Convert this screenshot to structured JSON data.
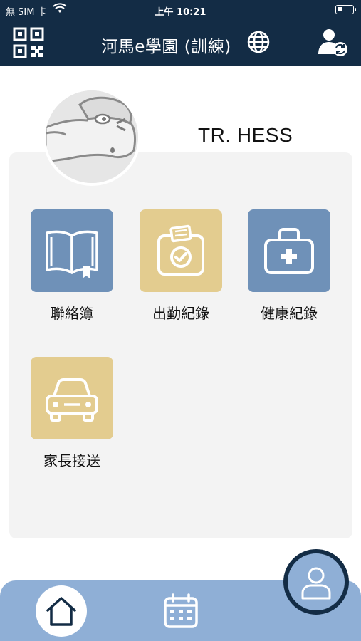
{
  "status_bar": {
    "carrier": "無 SIM 卡",
    "time": "上午 10:21",
    "icons": [
      "wifi-icon",
      "battery-icon"
    ]
  },
  "header": {
    "title": "河馬e學園 (訓練)",
    "icons": [
      "qr-code-icon",
      "globe-icon",
      "switch-user-icon"
    ]
  },
  "user": {
    "name": "TR. HESS",
    "avatar_icon": "hippo-avatar"
  },
  "menu": [
    {
      "label": "聯絡簿",
      "icon": "book-icon",
      "color": "#6f91b8"
    },
    {
      "label": "出勤紀錄",
      "icon": "attendance-clipboard-icon",
      "color": "#e3cc8f"
    },
    {
      "label": "健康紀錄",
      "icon": "medical-kit-icon",
      "color": "#6f91b8"
    },
    {
      "label": "家長接送",
      "icon": "car-icon",
      "color": "#e3cc8f"
    }
  ],
  "bottom_nav": {
    "items": [
      "home-icon",
      "calendar-icon",
      "profile-icon"
    ]
  },
  "colors": {
    "header": "#132c45",
    "blue_tile": "#6f91b8",
    "gold_tile": "#e3cc8f",
    "bottom_bar": "#8fafd6"
  }
}
